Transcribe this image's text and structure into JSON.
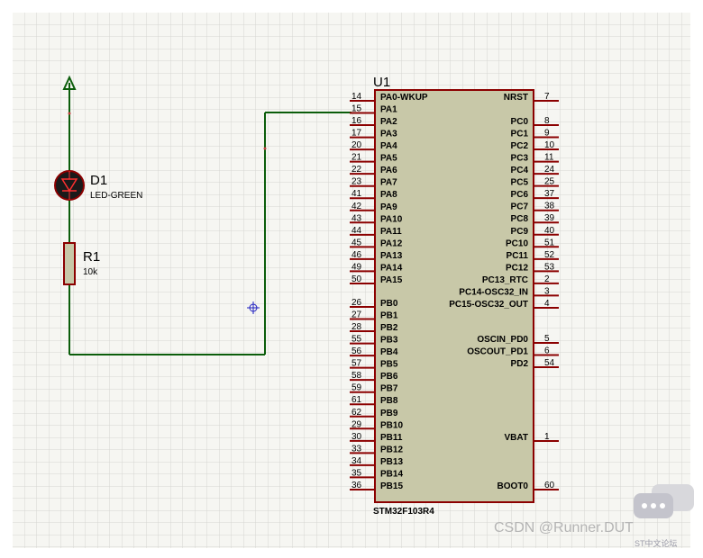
{
  "u1": {
    "ref": "U1",
    "part": "STM32F103R4",
    "left_pins": [
      {
        "num": "14",
        "name": "PA0-WKUP"
      },
      {
        "num": "15",
        "name": "PA1"
      },
      {
        "num": "16",
        "name": "PA2"
      },
      {
        "num": "17",
        "name": "PA3"
      },
      {
        "num": "20",
        "name": "PA4"
      },
      {
        "num": "21",
        "name": "PA5"
      },
      {
        "num": "22",
        "name": "PA6"
      },
      {
        "num": "23",
        "name": "PA7"
      },
      {
        "num": "41",
        "name": "PA8"
      },
      {
        "num": "42",
        "name": "PA9"
      },
      {
        "num": "43",
        "name": "PA10"
      },
      {
        "num": "44",
        "name": "PA11"
      },
      {
        "num": "45",
        "name": "PA12"
      },
      {
        "num": "46",
        "name": "PA13"
      },
      {
        "num": "49",
        "name": "PA14"
      },
      {
        "num": "50",
        "name": "PA15"
      },
      {
        "num": "26",
        "name": "PB0"
      },
      {
        "num": "27",
        "name": "PB1"
      },
      {
        "num": "28",
        "name": "PB2"
      },
      {
        "num": "55",
        "name": "PB3"
      },
      {
        "num": "56",
        "name": "PB4"
      },
      {
        "num": "57",
        "name": "PB5"
      },
      {
        "num": "58",
        "name": "PB6"
      },
      {
        "num": "59",
        "name": "PB7"
      },
      {
        "num": "61",
        "name": "PB8"
      },
      {
        "num": "62",
        "name": "PB9"
      },
      {
        "num": "29",
        "name": "PB10"
      },
      {
        "num": "30",
        "name": "PB11"
      },
      {
        "num": "33",
        "name": "PB12"
      },
      {
        "num": "34",
        "name": "PB13"
      },
      {
        "num": "35",
        "name": "PB14"
      },
      {
        "num": "36",
        "name": "PB15"
      }
    ],
    "right_pins_top": [
      {
        "num": "7",
        "name": "NRST"
      },
      {
        "num": "8",
        "name": "PC0"
      },
      {
        "num": "9",
        "name": "PC1"
      },
      {
        "num": "10",
        "name": "PC2"
      },
      {
        "num": "11",
        "name": "PC3"
      },
      {
        "num": "24",
        "name": "PC4"
      },
      {
        "num": "25",
        "name": "PC5"
      },
      {
        "num": "37",
        "name": "PC6"
      },
      {
        "num": "38",
        "name": "PC7"
      },
      {
        "num": "39",
        "name": "PC8"
      },
      {
        "num": "40",
        "name": "PC9"
      },
      {
        "num": "51",
        "name": "PC10"
      },
      {
        "num": "52",
        "name": "PC11"
      },
      {
        "num": "53",
        "name": "PC12"
      },
      {
        "num": "2",
        "name": "PC13_RTC"
      },
      {
        "num": "3",
        "name": "PC14-OSC32_IN"
      },
      {
        "num": "4",
        "name": "PC15-OSC32_OUT"
      }
    ],
    "right_pins_mid": [
      {
        "num": "5",
        "name": "OSCIN_PD0"
      },
      {
        "num": "6",
        "name": "OSCOUT_PD1"
      },
      {
        "num": "54",
        "name": "PD2"
      }
    ],
    "right_pins_bottom": [
      {
        "num": "1",
        "name": "VBAT"
      },
      {
        "num": "60",
        "name": "BOOT0"
      }
    ]
  },
  "d1": {
    "ref": "D1",
    "value": "LED-GREEN"
  },
  "r1": {
    "ref": "R1",
    "value": "10k"
  },
  "watermark": {
    "text": "CSDN @Runner.DUT",
    "sub": "ST中文论坛"
  },
  "colors": {
    "wire": "#0b5d0b",
    "body": "#c8c8a8",
    "grid": "#d8d8d8",
    "bg": "#f4f4f0",
    "pin": "#8b0000"
  }
}
